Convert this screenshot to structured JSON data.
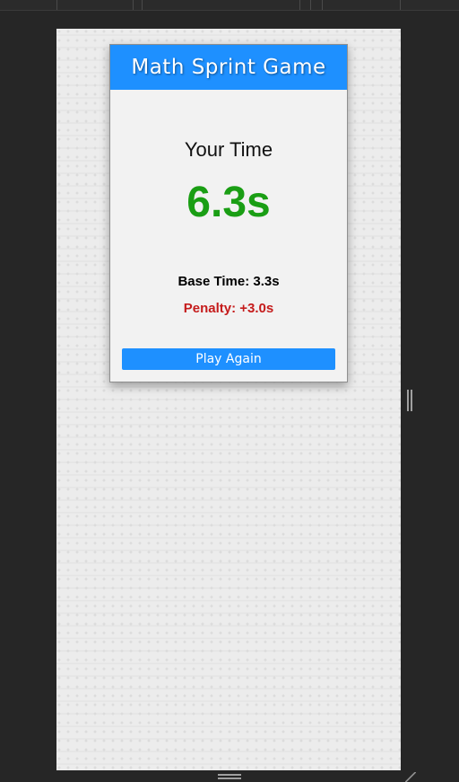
{
  "game": {
    "title": "Math Sprint Game"
  },
  "result": {
    "time_label": "Your Time",
    "final_time": "6.3s",
    "base_time": "Base Time: 3.3s",
    "penalty": "Penalty: +3.0s"
  },
  "actions": {
    "play_again_label": "Play Again"
  },
  "colors": {
    "accent": "#1e90ff",
    "final_time": "#1a9e14",
    "penalty": "#c51c1c"
  },
  "icons": {
    "side_resize": "vertical-resize-handle-icon",
    "bottom_resize": "horizontal-resize-handle-icon",
    "corner_resize": "corner-resize-icon"
  }
}
